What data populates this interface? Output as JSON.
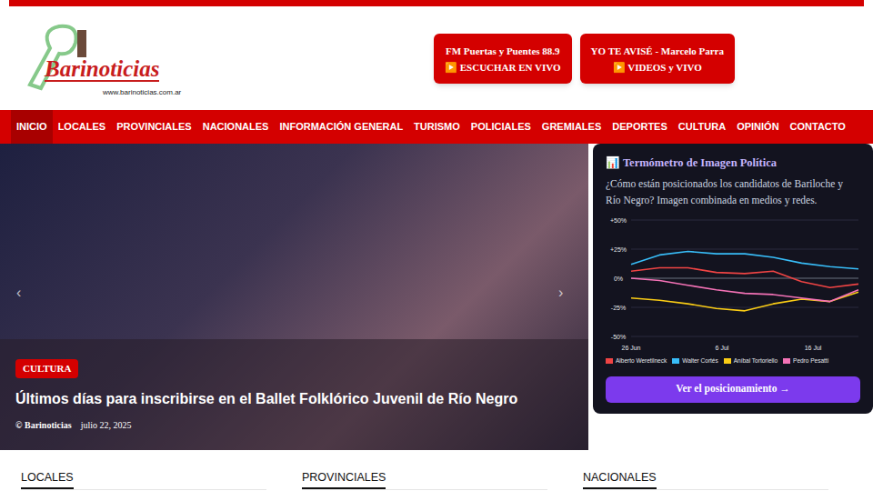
{
  "logo": {
    "name": "Barinoticias",
    "url": "www.barinoticias.com.ar"
  },
  "header_buttons": [
    {
      "title": "FM Puertas y Puentes 88.9",
      "action": "▶️ ESCUCHAR EN VIVO"
    },
    {
      "title": "YO TE AVISÉ - Marcelo Parra",
      "action": "▶️ VIDEOS y VIVO"
    }
  ],
  "nav": [
    {
      "label": "INICIO",
      "selected": true
    },
    {
      "label": "LOCALES",
      "selected": false
    },
    {
      "label": "PROVINCIALES",
      "selected": false
    },
    {
      "label": "NACIONALES",
      "selected": false
    },
    {
      "label": "INFORMACIÓN GENERAL",
      "selected": false
    },
    {
      "label": "TURISMO",
      "selected": false
    },
    {
      "label": "POLICIALES",
      "selected": false
    },
    {
      "label": "GREMIALES",
      "selected": false
    },
    {
      "label": "DEPORTES",
      "selected": false
    },
    {
      "label": "CULTURA",
      "selected": false
    },
    {
      "label": "OPINIÓN",
      "selected": false
    },
    {
      "label": "CONTACTO",
      "selected": false
    }
  ],
  "hero": {
    "category": "CULTURA",
    "title": "Últimos días para inscribirse en el Ballet Folklórico Juvenil de Río Negro",
    "author": "© Barinoticias",
    "date": "julio 22, 2025",
    "prev": "‹",
    "next": "›"
  },
  "poll": {
    "icon": "📊",
    "title": "Termómetro de Imagen Política",
    "subtitle": "¿Cómo están posicionados los candidatos de Bariloche y Río Negro? Imagen combinada en medios y redes.",
    "chart": {
      "y_ticks": [
        {
          "label": "+50%",
          "value": 50
        },
        {
          "label": "+25%",
          "value": 25
        },
        {
          "label": "0%",
          "value": 0
        },
        {
          "label": "-25%",
          "value": -25
        },
        {
          "label": "-50%",
          "value": -50
        }
      ],
      "x_ticks": [
        {
          "label": "26 Jun",
          "index": 0
        },
        {
          "label": "6 Jul",
          "index": 3.2
        },
        {
          "label": "16 Jul",
          "index": 6.4
        }
      ],
      "series": [
        {
          "name": "Alberto Weretilneck",
          "color": "#ef4444",
          "values": [
            6,
            9,
            9,
            5,
            4,
            6,
            -3,
            -8,
            -5
          ]
        },
        {
          "name": "Walter Cortés",
          "color": "#38bdf8",
          "values": [
            12,
            20,
            23,
            21,
            21,
            18,
            13,
            10,
            8
          ]
        },
        {
          "name": "Aníbal Tortoriello",
          "color": "#facc15",
          "values": [
            -17,
            -19,
            -22,
            -26,
            -28,
            -22,
            -18,
            -20,
            -12
          ]
        },
        {
          "name": "Pedro Pesatti",
          "color": "#f472b6",
          "values": [
            0,
            -2,
            -6,
            -10,
            -13,
            -14,
            -17,
            -20,
            -10
          ]
        }
      ]
    },
    "button": "Ver el posicionamiento →"
  },
  "sections": [
    "LOCALES",
    "PROVINCIALES",
    "NACIONALES"
  ]
}
